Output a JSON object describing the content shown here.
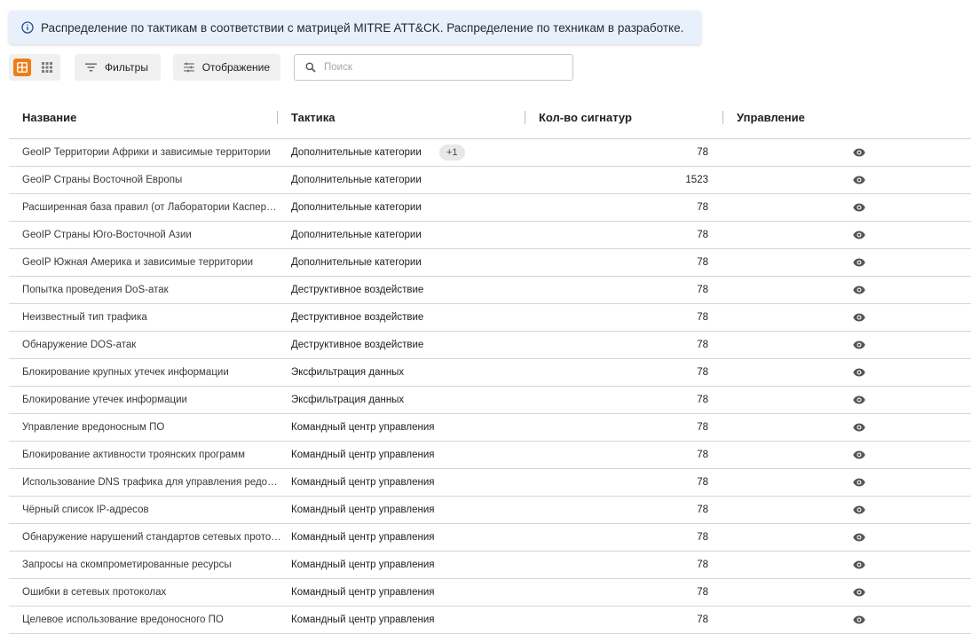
{
  "banner": {
    "icon": "info-icon",
    "text": "Распределение по тактикам в соответствии с матрицей MITRE ATT&CK. Распределение по техникам в разработке."
  },
  "toolbar": {
    "view_table_icon": "table-view-icon",
    "view_grid_icon": "grid-view-icon",
    "filters_label": "Фильтры",
    "display_label": "Отображение",
    "search_placeholder": "Поиск"
  },
  "colors": {
    "accent": "#ef7d14",
    "banner_bg": "#e8f1fb"
  },
  "table": {
    "headers": {
      "name": "Название",
      "tactic": "Тактика",
      "count": "Кол-во сигнатур",
      "manage": "Управление"
    },
    "rows": [
      {
        "name": "GeoIP Территории Африки и зависимые территории",
        "tactic": "Дополнительные категории",
        "badge": "+1",
        "count": "78"
      },
      {
        "name": "GeoIP Страны Восточной Европы",
        "tactic": "Дополнительные категории",
        "count": "1523"
      },
      {
        "name": "Расширенная база правил (от Лаборатории Касперского)",
        "tactic": "Дополнительные категории",
        "count": "78"
      },
      {
        "name": "GeoIP Страны Юго-Восточной Азии",
        "tactic": "Дополнительные категории",
        "count": "78"
      },
      {
        "name": "GeoIP Южная Америка и зависимые территории",
        "tactic": "Дополнительные категории",
        "count": "78"
      },
      {
        "name": "Попытка проведения DoS-атак",
        "tactic": "Деструктивное воздействие",
        "count": "78"
      },
      {
        "name": "Неизвестный тип трафика",
        "tactic": "Деструктивное воздействие",
        "count": "78"
      },
      {
        "name": "Обнаружение DOS-атак",
        "tactic": "Деструктивное воздействие",
        "count": "78"
      },
      {
        "name": "Блокирование крупных утечек информации",
        "tactic": "Эксфильтрация данных",
        "count": "78"
      },
      {
        "name": "Блокирование утечек информации",
        "tactic": "Эксфильтрация данных",
        "count": "78"
      },
      {
        "name": "Управление вредоносным ПО",
        "tactic": "Командный центр управления",
        "count": "78"
      },
      {
        "name": "Блокирование активности троянских программ",
        "tactic": "Командный центр управления",
        "count": "78"
      },
      {
        "name": "Использование DNS трафика для управления редоносным ПО",
        "tactic": "Командный центр управления",
        "count": "78"
      },
      {
        "name": "Чёрный список IP-адресов",
        "tactic": "Командный центр управления",
        "count": "78"
      },
      {
        "name": "Обнаружение нарушений стандартов сетевых протоколов",
        "tactic": "Командный центр управления",
        "count": "78"
      },
      {
        "name": "Запросы на скомпрометированные ресурсы",
        "tactic": "Командный центр управления",
        "count": "78"
      },
      {
        "name": "Ошибки в сетевых протоколах",
        "tactic": "Командный центр управления",
        "count": "78"
      },
      {
        "name": "Целевое использование вредоносного ПО",
        "tactic": "Командный центр управления",
        "count": "78"
      }
    ],
    "row_action_icon": "eye-icon"
  }
}
